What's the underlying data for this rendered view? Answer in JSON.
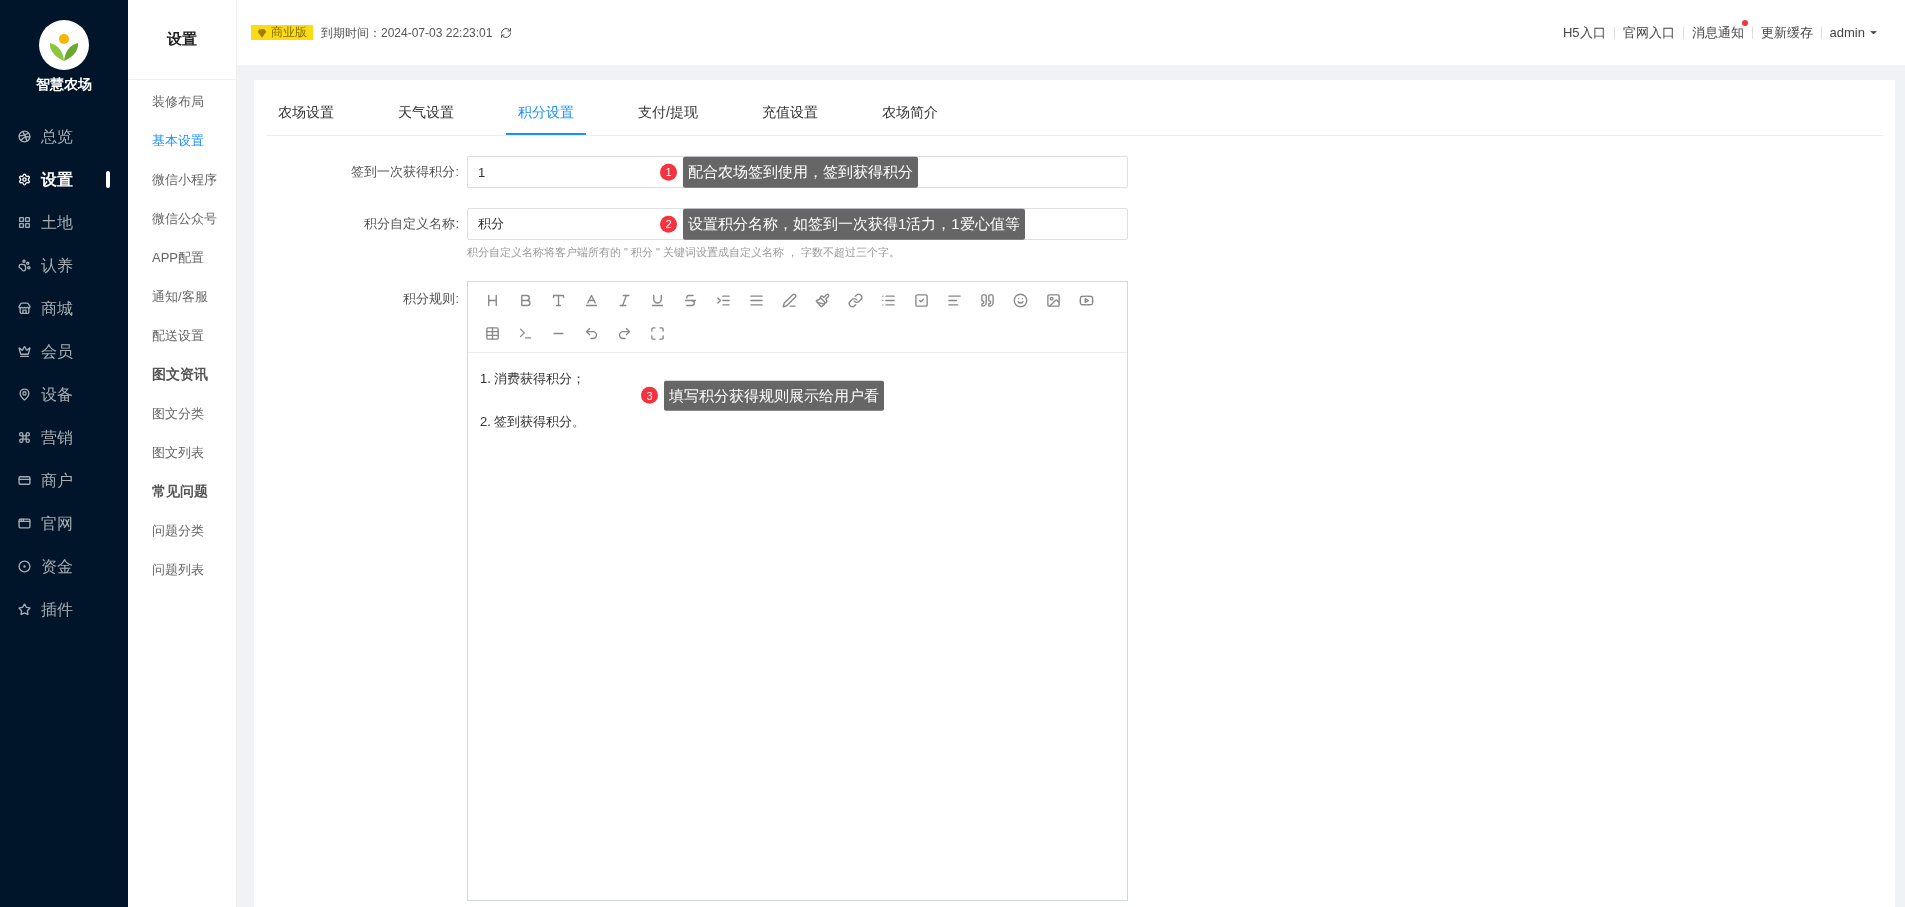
{
  "sidebar": {
    "logo_text": "智慧农场",
    "items": [
      {
        "label": "总览",
        "selected": false
      },
      {
        "label": "设置",
        "selected": true
      },
      {
        "label": "土地",
        "selected": false
      },
      {
        "label": "认养",
        "selected": false
      },
      {
        "label": "商城",
        "selected": false
      },
      {
        "label": "会员",
        "selected": false
      },
      {
        "label": "设备",
        "selected": false
      },
      {
        "label": "营销",
        "selected": false
      },
      {
        "label": "商户",
        "selected": false
      },
      {
        "label": "官网",
        "selected": false
      },
      {
        "label": "资金",
        "selected": false
      },
      {
        "label": "插件",
        "selected": false
      }
    ]
  },
  "submenu": {
    "title": "设置",
    "items": [
      {
        "kind": "item",
        "label": "装修布局",
        "selected": false
      },
      {
        "kind": "item",
        "label": "基本设置",
        "selected": true
      },
      {
        "kind": "item",
        "label": "微信小程序",
        "selected": false
      },
      {
        "kind": "item",
        "label": "微信公众号",
        "selected": false
      },
      {
        "kind": "item",
        "label": "APP配置",
        "selected": false
      },
      {
        "kind": "item",
        "label": "通知/客服",
        "selected": false
      },
      {
        "kind": "item",
        "label": "配送设置",
        "selected": false
      },
      {
        "kind": "heading",
        "label": "图文资讯"
      },
      {
        "kind": "item",
        "label": "图文分类",
        "selected": false
      },
      {
        "kind": "item",
        "label": "图文列表",
        "selected": false
      },
      {
        "kind": "heading",
        "label": "常见问题"
      },
      {
        "kind": "item",
        "label": "问题分类",
        "selected": false
      },
      {
        "kind": "item",
        "label": "问题列表",
        "selected": false
      }
    ]
  },
  "topbar": {
    "badge": "商业版",
    "expiry": "到期时间：2024-07-03 22:23:01",
    "links": [
      {
        "label": "H5入口",
        "unread": false
      },
      {
        "label": "官网入口",
        "unread": false
      },
      {
        "label": "消息通知",
        "unread": true
      },
      {
        "label": "更新缓存",
        "unread": false
      }
    ],
    "user": "admin"
  },
  "tabs": [
    {
      "label": "农场设置",
      "selected": false
    },
    {
      "label": "天气设置",
      "selected": false
    },
    {
      "label": "积分设置",
      "selected": true
    },
    {
      "label": "支付/提现",
      "selected": false
    },
    {
      "label": "充值设置",
      "selected": false
    },
    {
      "label": "农场简介",
      "selected": false
    }
  ],
  "form": {
    "fields": [
      {
        "label": "签到一次获得积分:",
        "value": "1",
        "annotation": {
          "number": "1",
          "text": "配合农场签到使用，签到获得积分"
        }
      },
      {
        "label": "积分自定义名称:",
        "value": "积分",
        "hint": "积分自定义名称将客户端所有的 \" 积分 \" 关键词设置成自定义名称 ， 字数不超过三个字。",
        "annotation": {
          "number": "2",
          "text": "设置积分名称，如签到一次获得1活力，1爱心值等"
        }
      }
    ],
    "editor": {
      "label": "积分规则:",
      "paragraphs": [
        "1. 消费获得积分；",
        "2. 签到获得积分。"
      ],
      "annotation": {
        "number": "3",
        "text": "填写积分获得规则展示给用户看"
      }
    }
  }
}
